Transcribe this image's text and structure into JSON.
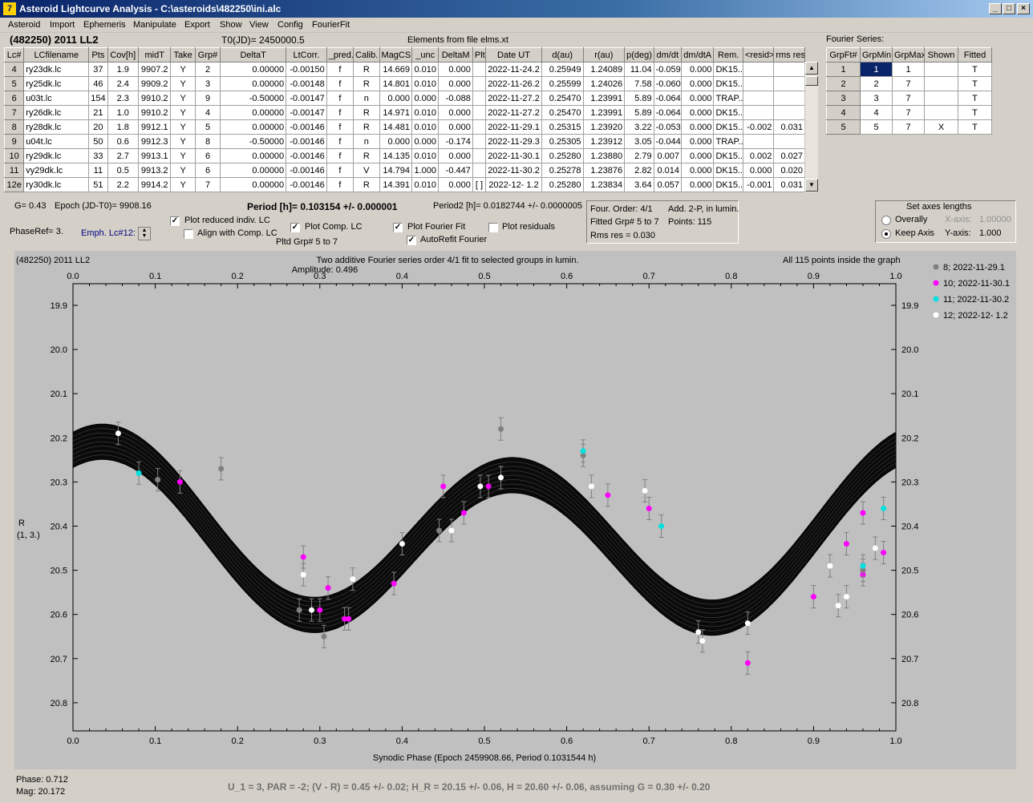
{
  "window": {
    "title": "Asteroid Lightcurve Analysis - C:\\asteroids\\482250\\ini.alc"
  },
  "menu": [
    "Asteroid",
    "Import",
    "Ephemeris",
    "Manipulate",
    "Export",
    "Show",
    "View",
    "Config",
    "FourierFit"
  ],
  "header": {
    "object": "(482250) 2011 LL2",
    "t0": "T0(JD)= 2450000.5",
    "elements": "Elements from file elms.xt"
  },
  "lc_table": {
    "columns": [
      "Lc#",
      "LCfilename",
      "Pts",
      "Cov[h]",
      "midT",
      "Take",
      "Grp#",
      "DeltaT",
      "LtCorr.",
      "_pred.",
      "Calib.",
      "MagCS",
      "_unc",
      "DeltaM",
      "Plt",
      "Date UT",
      "d(au)",
      "r(au)",
      "p(deg)",
      "dm/dt",
      "dm/dtA",
      "Rem.",
      "<resid>",
      "rms res"
    ],
    "rows": [
      [
        "4",
        "ry23dk.lc",
        "37",
        "1.9",
        "9907.2",
        "Y",
        "2",
        "0.00000",
        "-0.00150",
        "f",
        "R",
        "14.669",
        "0.010",
        "0.000",
        "",
        "2022-11-24.2",
        "0.25949",
        "1.24089",
        "11.04",
        "-0.059",
        "0.000",
        "DK15..",
        "",
        ""
      ],
      [
        "5",
        "ry25dk.lc",
        "46",
        "2.4",
        "9909.2",
        "Y",
        "3",
        "0.00000",
        "-0.00148",
        "f",
        "R",
        "14.801",
        "0.010",
        "0.000",
        "",
        "2022-11-26.2",
        "0.25599",
        "1.24026",
        "7.58",
        "-0.060",
        "0.000",
        "DK15..",
        "",
        ""
      ],
      [
        "6",
        "u03t.lc",
        "154",
        "2.3",
        "9910.2",
        "Y",
        "9",
        "-0.50000",
        "-0.00147",
        "f",
        "n",
        "0.000",
        "0.000",
        "-0.088",
        "",
        "2022-11-27.2",
        "0.25470",
        "1.23991",
        "5.89",
        "-0.064",
        "0.000",
        "TRAP..",
        "",
        ""
      ],
      [
        "7",
        "ry26dk.lc",
        "21",
        "1.0",
        "9910.2",
        "Y",
        "4",
        "0.00000",
        "-0.00147",
        "f",
        "R",
        "14.971",
        "0.010",
        "0.000",
        "",
        "2022-11-27.2",
        "0.25470",
        "1.23991",
        "5.89",
        "-0.064",
        "0.000",
        "DK15..",
        "",
        ""
      ],
      [
        "8",
        "ry28dk.lc",
        "20",
        "1.8",
        "9912.1",
        "Y",
        "5",
        "0.00000",
        "-0.00146",
        "f",
        "R",
        "14.481",
        "0.010",
        "0.000",
        "",
        "2022-11-29.1",
        "0.25315",
        "1.23920",
        "3.22",
        "-0.053",
        "0.000",
        "DK15..",
        "-0.002",
        "0.031"
      ],
      [
        "9",
        "u04t.lc",
        "50",
        "0.6",
        "9912.3",
        "Y",
        "8",
        "-0.50000",
        "-0.00146",
        "f",
        "n",
        "0.000",
        "0.000",
        "-0.174",
        "",
        "2022-11-29.3",
        "0.25305",
        "1.23912",
        "3.05",
        "-0.044",
        "0.000",
        "TRAP..",
        "",
        ""
      ],
      [
        "10",
        "ry29dk.lc",
        "33",
        "2.7",
        "9913.1",
        "Y",
        "6",
        "0.00000",
        "-0.00146",
        "f",
        "R",
        "14.135",
        "0.010",
        "0.000",
        "",
        "2022-11-30.1",
        "0.25280",
        "1.23880",
        "2.79",
        "0.007",
        "0.000",
        "DK15..",
        "0.002",
        "0.027"
      ],
      [
        "11",
        "vy29dk.lc",
        "11",
        "0.5",
        "9913.2",
        "Y",
        "6",
        "0.00000",
        "-0.00146",
        "f",
        "V",
        "14.794",
        "1.000",
        "-0.447",
        "",
        "2022-11-30.2",
        "0.25278",
        "1.23876",
        "2.82",
        "0.014",
        "0.000",
        "DK15..",
        "0.000",
        "0.020"
      ],
      [
        "12e",
        "ry30dk.lc",
        "51",
        "2.2",
        "9914.2",
        "Y",
        "7",
        "0.00000",
        "-0.00146",
        "f",
        "R",
        "14.391",
        "0.010",
        "0.000",
        "[ ]",
        "2022-12- 1.2",
        "0.25280",
        "1.23834",
        "3.64",
        "0.057",
        "0.000",
        "DK15..",
        "-0.001",
        "0.031"
      ]
    ]
  },
  "fourier": {
    "title": "Fourier Series:",
    "columns": [
      "GrpFt#",
      "GrpMin",
      "GrpMax",
      "Shown",
      "Fitted"
    ],
    "rows": [
      [
        "1",
        "1",
        "1",
        "",
        "T"
      ],
      [
        "2",
        "2",
        "7",
        "",
        "T"
      ],
      [
        "3",
        "3",
        "7",
        "",
        "T"
      ],
      [
        "4",
        "4",
        "7",
        "",
        "T"
      ],
      [
        "5",
        "5",
        "7",
        "X",
        "T"
      ]
    ]
  },
  "info": {
    "g": "G= 0.43",
    "epoch": "Epoch (JD-T0)= 9908.16",
    "period": "Period [h]= 0.103154 +/- 0.000001",
    "period2": "Period2 [h]= 0.0182744 +/- 0.0000005",
    "phaseref": "PhaseRef= 3.",
    "emph": "Emph. Lc#12:",
    "four_order": "Four. Order:  4/1",
    "add": "Add. 2-P, in lumin.",
    "fitted": "Fitted Grp# 5 to 7",
    "points": "Points: 115",
    "rms": "Rms res     = 0.030"
  },
  "options": {
    "plot_reduced": "Plot reduced indiv. LC",
    "align": "Align with Comp. LC",
    "plot_comp": "Plot Comp. LC",
    "plot_fourier": "Plot Fourier Fit",
    "plot_resid": "Plot residuals",
    "pltd_grp": "Pltd Grp#  5  to  7",
    "autorefit": "AutoRefit Fourier"
  },
  "axes_box": {
    "title": "Set axes lengths",
    "overally": "Overally",
    "keep": "Keep Axis",
    "xaxis": "X-axis:",
    "xval": "1.00000",
    "yaxis": "Y-axis:",
    "yval": "1.000"
  },
  "chart_data": {
    "type": "scatter",
    "object_label": "(482250) 2011 LL2",
    "title": "Two additive Fourier series order 4/1 fit to selected groups in lumin.",
    "subtitle": "Amplitude: 0.496",
    "note": "All 115 points inside the graph",
    "xlabel": "Synodic Phase (Epoch 2459908.66, Period 0.1031544 h)",
    "ylabel": "R",
    "ylabel2": "(1, 3.)",
    "xlim": [
      0,
      1
    ],
    "ylim": [
      20.9,
      19.9
    ],
    "y_reversed": true,
    "xticks": [
      "0.0",
      "0.1",
      "0.2",
      "0.3",
      "0.4",
      "0.5",
      "0.6",
      "0.7",
      "0.8",
      "0.9",
      "1.0"
    ],
    "yticks": [
      "19.9",
      "20.0",
      "20.1",
      "20.2",
      "20.3",
      "20.4",
      "20.5",
      "20.6",
      "20.7",
      "20.8"
    ],
    "series": [
      {
        "name": "8; 2022-11-29.1",
        "color": "#808080",
        "points": [
          [
            0.103,
            20.295
          ],
          [
            0.18,
            20.27
          ],
          [
            0.275,
            20.59
          ],
          [
            0.305,
            20.65
          ],
          [
            0.445,
            20.41
          ],
          [
            0.52,
            20.18
          ],
          [
            0.62,
            20.24
          ],
          [
            0.96,
            20.5
          ]
        ]
      },
      {
        "name": "10; 2022-11-30.1",
        "color": "#ff00ff",
        "points": [
          [
            0.13,
            20.3
          ],
          [
            0.28,
            20.47
          ],
          [
            0.3,
            20.59
          ],
          [
            0.31,
            20.54
          ],
          [
            0.33,
            20.61
          ],
          [
            0.335,
            20.61
          ],
          [
            0.39,
            20.53
          ],
          [
            0.45,
            20.31
          ],
          [
            0.475,
            20.37
          ],
          [
            0.505,
            20.31
          ],
          [
            0.65,
            20.33
          ],
          [
            0.7,
            20.36
          ],
          [
            0.82,
            20.71
          ],
          [
            0.9,
            20.56
          ],
          [
            0.94,
            20.44
          ],
          [
            0.96,
            20.37
          ],
          [
            0.96,
            20.51
          ],
          [
            0.985,
            20.46
          ]
        ]
      },
      {
        "name": "11; 2022-11-30.2",
        "color": "#00e0e0",
        "points": [
          [
            0.08,
            20.28
          ],
          [
            0.62,
            20.23
          ],
          [
            0.715,
            20.4
          ],
          [
            0.96,
            20.49
          ],
          [
            0.985,
            20.36
          ]
        ]
      },
      {
        "name": "12; 2022-12- 1.2",
        "color": "#ffffff",
        "points": [
          [
            0.055,
            20.19
          ],
          [
            0.28,
            20.51
          ],
          [
            0.29,
            20.59
          ],
          [
            0.34,
            20.52
          ],
          [
            0.4,
            20.44
          ],
          [
            0.46,
            20.41
          ],
          [
            0.495,
            20.31
          ],
          [
            0.52,
            20.29
          ],
          [
            0.63,
            20.31
          ],
          [
            0.695,
            20.32
          ],
          [
            0.76,
            20.64
          ],
          [
            0.765,
            20.66
          ],
          [
            0.82,
            20.62
          ],
          [
            0.92,
            20.49
          ],
          [
            0.93,
            20.58
          ],
          [
            0.94,
            20.56
          ],
          [
            0.975,
            20.45
          ]
        ]
      }
    ],
    "fit": {
      "mean": 20.425,
      "amp": 0.18,
      "band": 0.04
    }
  },
  "status": {
    "phase": "Phase:  0.712",
    "mag": "Mag:    20.172",
    "summary": "U_1 = 3, PAR = -2; (V - R) = 0.45 +/- 0.02; H_R = 20.15 +/- 0.06, H = 20.60 +/- 0.06, assuming G = 0.30 +/- 0.20"
  }
}
